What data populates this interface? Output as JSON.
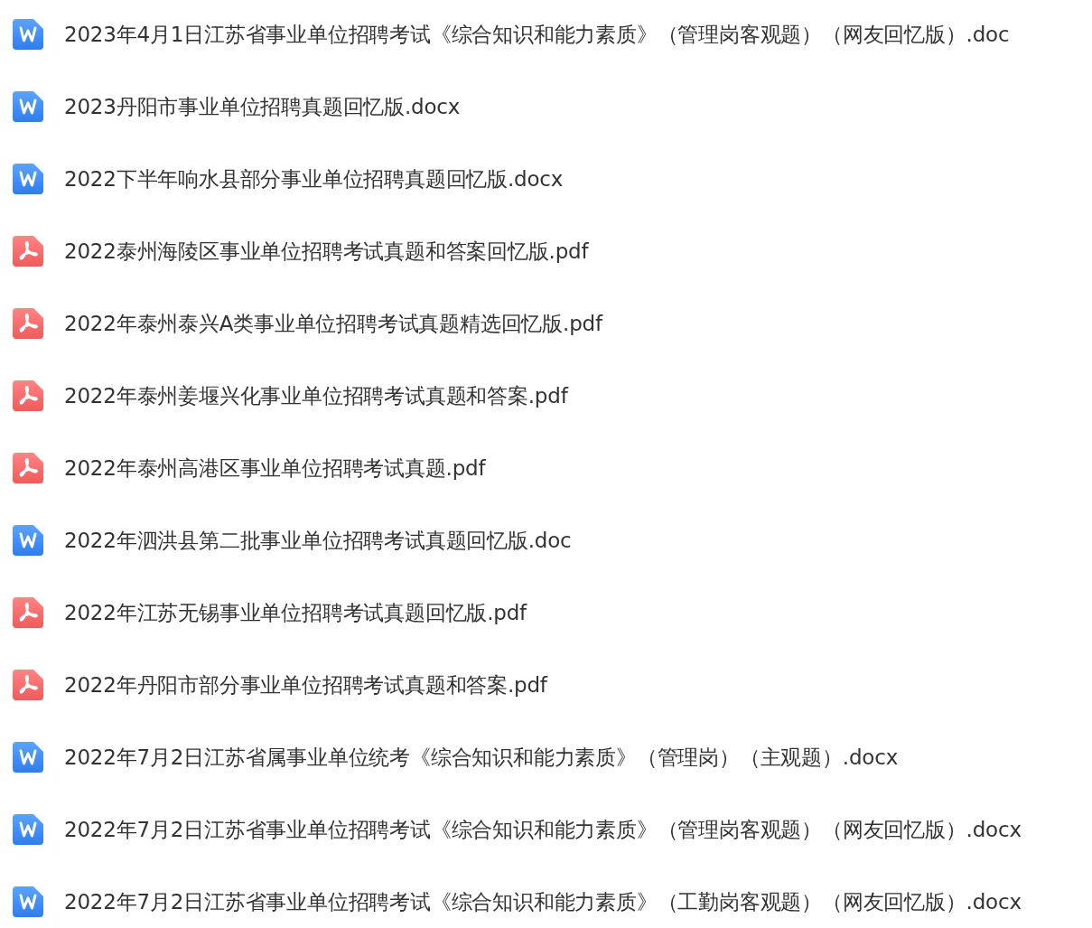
{
  "files": [
    {
      "name": "2023年4月1日江苏省事业单位招聘考试《综合知识和能力素质》（管理岗客观题）（网友回忆版）.doc",
      "kind": "word"
    },
    {
      "name": "2023丹阳市事业单位招聘真题回忆版.docx",
      "kind": "word"
    },
    {
      "name": "2022下半年响水县部分事业单位招聘真题回忆版.docx",
      "kind": "word"
    },
    {
      "name": "2022泰州海陵区事业单位招聘考试真题和答案回忆版.pdf",
      "kind": "pdf"
    },
    {
      "name": "2022年泰州泰兴A类事业单位招聘考试真题精选回忆版.pdf",
      "kind": "pdf"
    },
    {
      "name": "2022年泰州姜堰兴化事业单位招聘考试真题和答案.pdf",
      "kind": "pdf"
    },
    {
      "name": "2022年泰州高港区事业单位招聘考试真题.pdf",
      "kind": "pdf"
    },
    {
      "name": "2022年泗洪县第二批事业单位招聘考试真题回忆版.doc",
      "kind": "word"
    },
    {
      "name": "2022年江苏无锡事业单位招聘考试真题回忆版.pdf",
      "kind": "pdf"
    },
    {
      "name": "2022年丹阳市部分事业单位招聘考试真题和答案.pdf",
      "kind": "pdf"
    },
    {
      "name": "2022年7月2日江苏省属事业单位统考《综合知识和能力素质》（管理岗）（主观题）.docx",
      "kind": "word"
    },
    {
      "name": "2022年7月2日江苏省事业单位招聘考试《综合知识和能力素质》（管理岗客观题）（网友回忆版）.docx",
      "kind": "word"
    },
    {
      "name": "2022年7月2日江苏省事业单位招聘考试《综合知识和能力素质》（工勤岗客观题）（网友回忆版）.docx",
      "kind": "word"
    }
  ]
}
